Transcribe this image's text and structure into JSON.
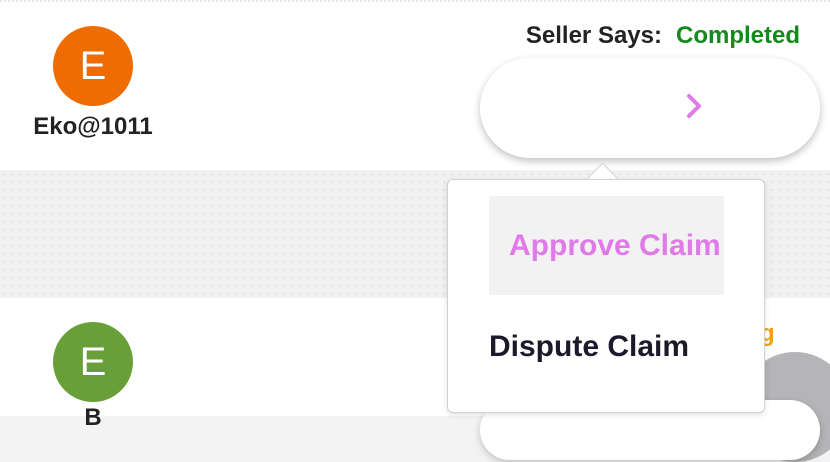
{
  "claim_1": {
    "user": {
      "avatar_letter": "E",
      "username": "Eko@1011",
      "avatar_color": "#ef6c00"
    },
    "seller_says_label": "Seller Says:",
    "seller_status": "Completed",
    "seller_status_color": "#138a1b",
    "action_icon": "chevron-right-icon"
  },
  "claim_2": {
    "user": {
      "avatar_letter": "E",
      "username": "B",
      "avatar_color": "#689f38"
    },
    "status_fragment": "g",
    "status_color": "#f0a020"
  },
  "claim_menu": {
    "items": [
      {
        "label": "Approve Claim",
        "highlighted": true,
        "color": "#e07ae8"
      },
      {
        "label": "Dispute Claim",
        "highlighted": false,
        "color": "#1a1a2a"
      }
    ]
  }
}
